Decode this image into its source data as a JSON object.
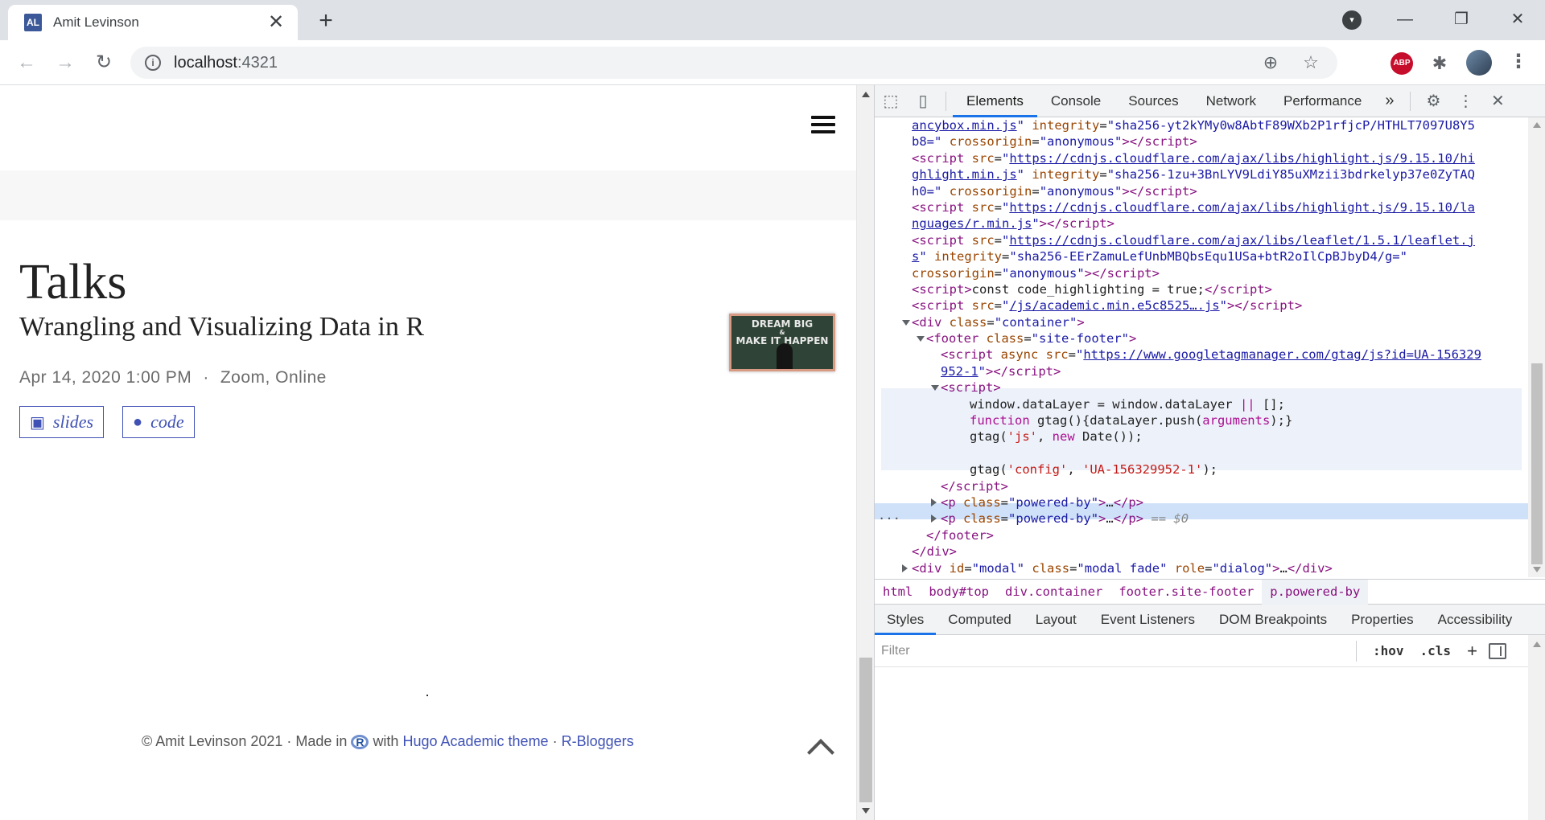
{
  "browser": {
    "tab_title": "Amit Levinson",
    "favicon_text": "AL",
    "tab_close": "✕",
    "new_tab": "+",
    "url_host": "localhost",
    "url_port": ":4321",
    "abp_label": "ABP",
    "colors": {
      "tabstrip": "#dee1e6",
      "favicon": "#3b5998",
      "abp": "#c70d2c"
    }
  },
  "page": {
    "heading": "Talks",
    "talk": {
      "title": "Wrangling and Visualizing Data in R",
      "date": "Apr 14, 2020 1:00 PM",
      "separator": "·",
      "location": "Zoom, Online",
      "thumb_line1": "DREAM BIG",
      "thumb_line2": "&",
      "thumb_line3": "MAKE IT HAPPEN",
      "slides_label": "slides",
      "code_label": "code"
    },
    "footer": {
      "prefix": "© Amit Levinson 2021 · Made in",
      "r_logo": "R",
      "with": "with",
      "theme_link": "Hugo Academic theme",
      "dot": "·",
      "bloggers_link": "R-Bloggers"
    },
    "colors": {
      "accent": "#3f51b5",
      "band": "#f7f7f7"
    }
  },
  "devtools": {
    "tabs": [
      "Elements",
      "Console",
      "Sources",
      "Network",
      "Performance"
    ],
    "more": "»",
    "dom": {
      "l1_val": "ancybox.min.js",
      "l1_attr": "integrity",
      "l1_intval": "sha256-yt2kYMy0w8AbtF89WXb2P1rfjcP/HTHLT7097U8Y5",
      "l2_intval": "b8=",
      "cross": "crossorigin",
      "anon": "anonymous",
      "hl_src": "https://cdnjs.cloudflare.com/ajax/libs/highlight.js/9.15.10/hi",
      "hl_src2": "ghlight.min.js",
      "hl_int": "sha256-1zu+3BnLYV9LdiY85uXMzii3bdrkelyp37e0ZyTAQ",
      "hl_int2": "h0=",
      "r_src": "https://cdnjs.cloudflare.com/ajax/libs/highlight.js/9.15.10/la",
      "r_src2": "nguages/r.min.js",
      "lf_src": "https://cdnjs.cloudflare.com/ajax/libs/leaflet/1.5.1/leaflet.j",
      "lf_src2": "s",
      "lf_int": "sha256-EErZamuLefUnbMBQbsEqu1USa+btR2oIlCpBJbyD4/g=",
      "code_hl": "const code_highlighting = true;",
      "acad_src": "/js/academic.min.e5c8525….js",
      "container": "container",
      "footer_class": "site-footer",
      "gtm_src": "https://www.googletagmanager.com/gtag/js?id=UA-156329",
      "gtm_src2": "952-1",
      "js1a": "window.dataLayer = window.dataLayer ",
      "js1b": "||",
      "js1c": " [];",
      "js2a": "function",
      "js2b": " gtag(){dataLayer.push(",
      "js2c": "arguments",
      "js2d": ");}",
      "js3a": "gtag(",
      "js3b": "'js'",
      "js3c": ", ",
      "js3d": "new",
      "js3e": " Date());",
      "js4a": "gtag(",
      "js4b": "'config'",
      "js4c": ", ",
      "js4d": "'UA-156329952-1'",
      "js4e": ");",
      "powered": "powered-by",
      "ellipsis": "…",
      "eq0": " == $0",
      "dots": "···",
      "modal_id": "modal",
      "modal_class": "modal fade",
      "modal_role": "dialog"
    },
    "breadcrumbs": [
      "html",
      "body#top",
      "div.container",
      "footer.site-footer",
      "p.powered-by"
    ],
    "styles_tabs": [
      "Styles",
      "Computed",
      "Layout",
      "Event Listeners",
      "DOM Breakpoints",
      "Properties",
      "Accessibility"
    ],
    "filter_placeholder": "Filter",
    "hov": ":hov",
    "cls": ".cls",
    "plus": "+"
  }
}
